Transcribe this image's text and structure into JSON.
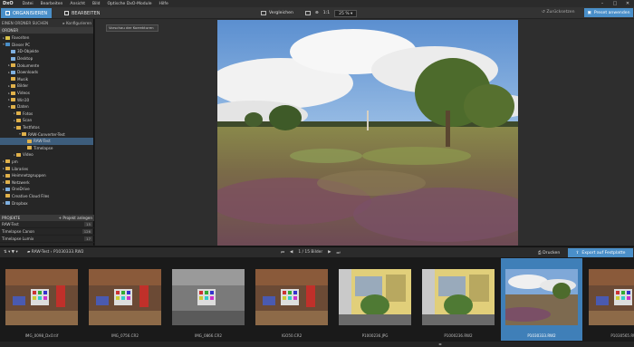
{
  "app": {
    "logo": "DxO",
    "menu": [
      "Datei",
      "Bearbeiten",
      "Ansicht",
      "Bild",
      "Optische DxO-Module",
      "Hilfe"
    ],
    "window_controls": [
      "–",
      "□",
      "✕"
    ]
  },
  "toolbar": {
    "tab_organize": "ORGANISIEREN",
    "tab_edit": "BEARBEITEN",
    "compare": "Vergleichen",
    "ratio": "1:1",
    "zoom": "25 %",
    "reset": "Zurücksetzen",
    "apply_preset": "Preset anwenden"
  },
  "left": {
    "find_folder": "EINEN ORDNER SUCHEN",
    "configure": "Konfigurieren",
    "folders_header": "ORDNER",
    "tree": [
      {
        "label": "Favoriten",
        "depth": 0,
        "twisty": "▸",
        "icon": "star"
      },
      {
        "label": "Dieser PC",
        "depth": 0,
        "twisty": "▾",
        "icon": "pc"
      },
      {
        "label": "3D-Objekte",
        "depth": 1,
        "twisty": "",
        "icon": "folder-blue"
      },
      {
        "label": "Desktop",
        "depth": 1,
        "twisty": "",
        "icon": "folder-blue"
      },
      {
        "label": "Dokumente",
        "depth": 1,
        "twisty": "▸",
        "icon": "folder"
      },
      {
        "label": "Downloads",
        "depth": 1,
        "twisty": "▸",
        "icon": "folder-blue"
      },
      {
        "label": "Musik",
        "depth": 1,
        "twisty": "",
        "icon": "folder"
      },
      {
        "label": "Bilder",
        "depth": 1,
        "twisty": "▸",
        "icon": "folder"
      },
      {
        "label": "Videos",
        "depth": 1,
        "twisty": "▸",
        "icon": "folder"
      },
      {
        "label": "Win10",
        "depth": 1,
        "twisty": "▸",
        "icon": "folder"
      },
      {
        "label": "Daten",
        "depth": 1,
        "twisty": "▾",
        "icon": "folder"
      },
      {
        "label": "Fotos",
        "depth": 2,
        "twisty": "▸",
        "icon": "folder"
      },
      {
        "label": "Scan",
        "depth": 2,
        "twisty": "▸",
        "icon": "folder"
      },
      {
        "label": "Testfotos",
        "depth": 2,
        "twisty": "▾",
        "icon": "folder"
      },
      {
        "label": "RAW-Converter-Test",
        "depth": 3,
        "twisty": "▾",
        "icon": "folder"
      },
      {
        "label": "RAW-Test",
        "depth": 4,
        "twisty": "",
        "icon": "folder",
        "selected": true
      },
      {
        "label": "Timelapse",
        "depth": 4,
        "twisty": "",
        "icon": "folder"
      },
      {
        "label": "Video",
        "depth": 2,
        "twisty": "▸",
        "icon": "folder"
      },
      {
        "label": "pm",
        "depth": 0,
        "twisty": "▸",
        "icon": "folder"
      },
      {
        "label": "Libraries",
        "depth": 0,
        "twisty": "▸",
        "icon": "folder"
      },
      {
        "label": "Heimnetzgruppen",
        "depth": 0,
        "twisty": "▸",
        "icon": "folder"
      },
      {
        "label": "Netzwerk",
        "depth": 0,
        "twisty": "▸",
        "icon": "folder"
      },
      {
        "label": "OneDrive",
        "depth": 0,
        "twisty": "▸",
        "icon": "folder-blue"
      },
      {
        "label": "Creative Cloud Files",
        "depth": 0,
        "twisty": "",
        "icon": "folder"
      },
      {
        "label": "Dropbox",
        "depth": 0,
        "twisty": "▸",
        "icon": "folder-blue"
      }
    ],
    "projects_header": "PROJEKTE",
    "new_project": "+ Projekt anlegen",
    "projects": [
      {
        "name": "RAW-Test",
        "count": "15"
      },
      {
        "name": "Timelapse Canon",
        "count": "126"
      },
      {
        "name": "Timelapse Lumix",
        "count": "17"
      }
    ]
  },
  "viewer": {
    "tooltip": "Vorschau der Korrekturen"
  },
  "strip_header": {
    "path_folder": "RAW-Test",
    "path_file": "P1030333.RW2",
    "nav_counter": "1 / 15 Bilder",
    "print": "Drucken",
    "export": "Export auf Festplatte"
  },
  "thumbnails": [
    {
      "caption": "IMG_0098_DxO.tif",
      "scene": "studio",
      "selected": false
    },
    {
      "caption": "IMG_0756.CR2",
      "scene": "studio",
      "selected": false
    },
    {
      "caption": "IMG_0866.CR2",
      "scene": "studio-grey",
      "selected": false
    },
    {
      "caption": "IGO50.CR2",
      "scene": "studio",
      "selected": false
    },
    {
      "caption": "P1000236.JPG",
      "scene": "house",
      "selected": false
    },
    {
      "caption": "P1000236.RW2",
      "scene": "house",
      "selected": false
    },
    {
      "caption": "P1030333.RW2",
      "scene": "landscape",
      "selected": true
    },
    {
      "caption": "P1030565.RW2",
      "scene": "studio",
      "selected": false
    }
  ]
}
